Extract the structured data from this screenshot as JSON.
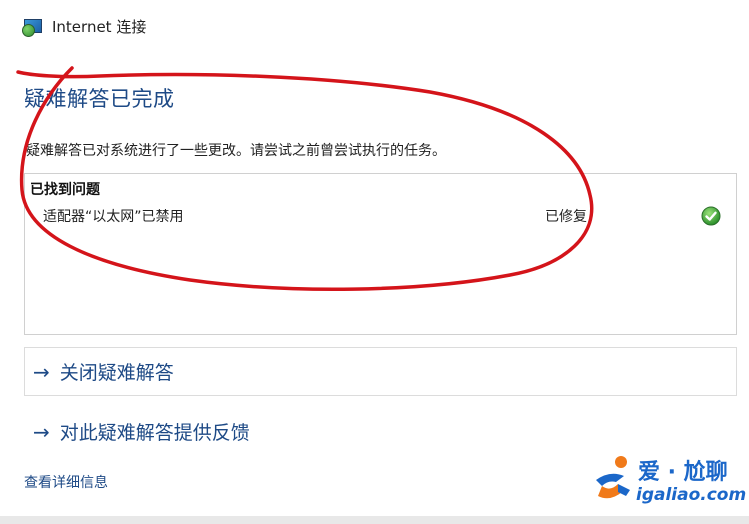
{
  "window": {
    "title": "Internet 连接",
    "icon": "network-icon"
  },
  "panel": {
    "title": "疑难解答已完成",
    "description": "疑难解答已对系统进行了一些更改。请尝试之前曾尝试执行的任务。"
  },
  "problems": {
    "heading": "已找到问题",
    "items": [
      {
        "name": "适配器“以太网”已禁用",
        "status": "已修复",
        "status_icon": "check-icon"
      }
    ]
  },
  "actions": {
    "close": "关闭疑难解答",
    "feedback": "对此疑难解答提供反馈"
  },
  "details_link": "查看详细信息",
  "watermark": {
    "brand": "爱 · 尬聊",
    "url": "igaliao.com"
  },
  "colors": {
    "accent": "#1e4a86",
    "annotation": "#d4141a",
    "success": "#2c9a2c"
  }
}
